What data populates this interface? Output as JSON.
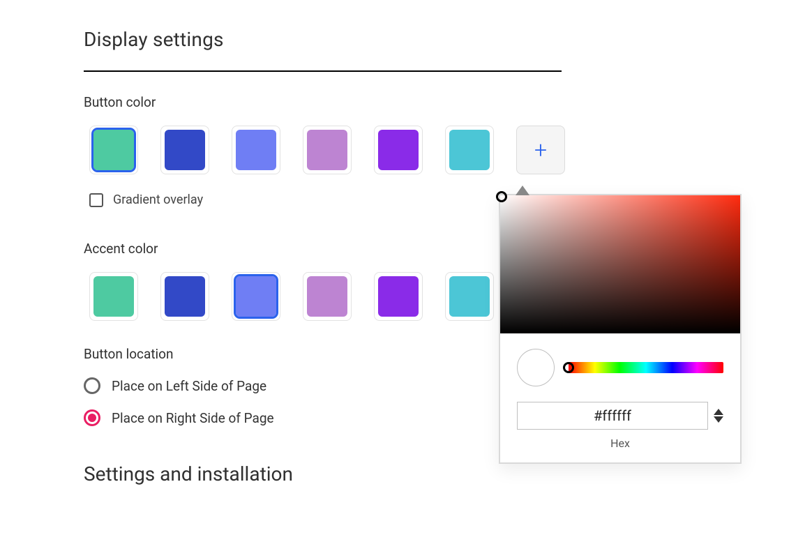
{
  "section_title": "Display settings",
  "button_color": {
    "label": "Button color",
    "swatches": [
      {
        "name": "teal",
        "hex": "#4ecaa1",
        "selected": true
      },
      {
        "name": "blue",
        "hex": "#3249c7",
        "selected": false
      },
      {
        "name": "periwinkle",
        "hex": "#6f7ef4",
        "selected": false
      },
      {
        "name": "orchid",
        "hex": "#bd84d2",
        "selected": false
      },
      {
        "name": "purple",
        "hex": "#8a2be8",
        "selected": false
      },
      {
        "name": "cyan",
        "hex": "#4cc6d6",
        "selected": false
      }
    ]
  },
  "gradient_overlay": {
    "label": "Gradient overlay",
    "checked": false
  },
  "accent_color": {
    "label": "Accent color",
    "swatches": [
      {
        "name": "teal",
        "hex": "#4ecaa1",
        "selected": false
      },
      {
        "name": "blue",
        "hex": "#3249c7",
        "selected": false
      },
      {
        "name": "periwinkle",
        "hex": "#6f7ef4",
        "selected": true
      },
      {
        "name": "orchid",
        "hex": "#bd84d2",
        "selected": false
      },
      {
        "name": "purple",
        "hex": "#8a2be8",
        "selected": false
      },
      {
        "name": "cyan",
        "hex": "#4cc6d6",
        "selected": false
      }
    ]
  },
  "button_location": {
    "label": "Button location",
    "options": [
      {
        "key": "left",
        "label": "Place on Left Side of Page",
        "checked": false
      },
      {
        "key": "right",
        "label": "Place on Right Side of Page",
        "checked": true
      }
    ]
  },
  "install_title": "Settings and installation",
  "color_picker": {
    "hex_value": "#ffffff",
    "hex_label": "Hex",
    "preview_hex": "#ffffff"
  }
}
